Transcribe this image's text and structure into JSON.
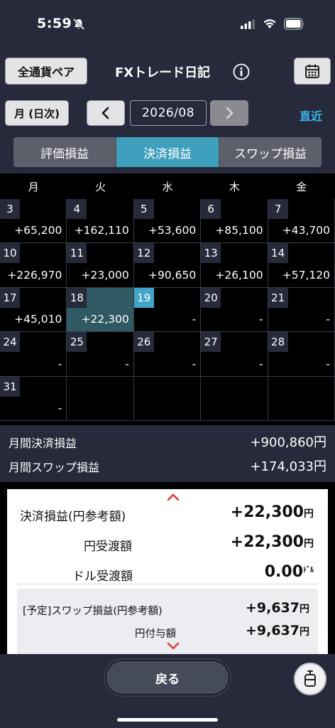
{
  "status": {
    "time": "5:59"
  },
  "header": {
    "pair_button": "全通貨ペア",
    "title": "FXトレード日記"
  },
  "nav": {
    "mode_button": "月 (日次)",
    "prev": "‹",
    "month": "2026/08",
    "latest": "直近"
  },
  "tabs": [
    {
      "label": "評価損益",
      "active": false
    },
    {
      "label": "決済損益",
      "active": true
    },
    {
      "label": "スワップ損益",
      "active": false
    }
  ],
  "weekdays": [
    "月",
    "火",
    "水",
    "木",
    "金"
  ],
  "calendar": [
    [
      {
        "day": "3",
        "value": "+65,200"
      },
      {
        "day": "4",
        "value": "+162,110"
      },
      {
        "day": "5",
        "value": "+53,600"
      },
      {
        "day": "6",
        "value": "+85,100"
      },
      {
        "day": "7",
        "value": "+43,700"
      }
    ],
    [
      {
        "day": "10",
        "value": "+226,970"
      },
      {
        "day": "11",
        "value": "+23,000"
      },
      {
        "day": "12",
        "value": "+90,650"
      },
      {
        "day": "13",
        "value": "+26,100"
      },
      {
        "day": "14",
        "value": "+57,120"
      }
    ],
    [
      {
        "day": "17",
        "value": "+45,010"
      },
      {
        "day": "18",
        "value": "+22,300",
        "selected": true
      },
      {
        "day": "19",
        "value": "-",
        "today": true
      },
      {
        "day": "20",
        "value": "-"
      },
      {
        "day": "21",
        "value": "-"
      }
    ],
    [
      {
        "day": "24",
        "value": "-"
      },
      {
        "day": "25",
        "value": "-"
      },
      {
        "day": "26",
        "value": "-"
      },
      {
        "day": "27",
        "value": "-"
      },
      {
        "day": "28",
        "value": "-"
      }
    ],
    [
      {
        "day": "31",
        "value": "-"
      },
      {
        "day": "",
        "value": ""
      },
      {
        "day": "",
        "value": ""
      },
      {
        "day": "",
        "value": ""
      },
      {
        "day": "",
        "value": ""
      }
    ]
  ],
  "summary": {
    "monthly_settlement_label": "月間決済損益",
    "monthly_settlement_value": "+900,860円",
    "monthly_swap_label": "月間スワップ損益",
    "monthly_swap_value": "+174,033円"
  },
  "detail": {
    "settlement_label": "決済損益(円参考額)",
    "settlement_value": "+22,300",
    "yen_delivery_label": "円受渡額",
    "yen_delivery_value": "+22,300",
    "dollar_delivery_label": "ドル受渡額",
    "dollar_delivery_value": "0.00",
    "yen_unit": "円",
    "dollar_unit": "ﾄﾞﾙ",
    "scheduled_swap_label": "[予定]スワップ損益(円参考額)",
    "scheduled_swap_value": "+9,637",
    "yen_grant_label": "円付与額",
    "yen_grant_value": "+9,637"
  },
  "bottom": {
    "back_button": "戻る"
  },
  "colors": {
    "bar_bg": "#262a3a",
    "accent_tab": "#3fa0bd",
    "today": "#42a5c8",
    "selected_cell": "#2f5963",
    "link": "#38b6e8",
    "chevron": "#e23b2e"
  }
}
